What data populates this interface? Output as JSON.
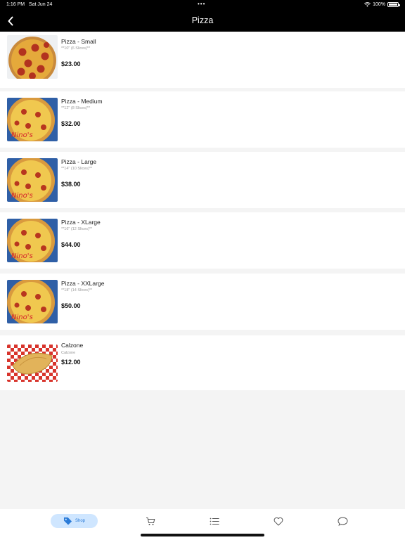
{
  "status_bar": {
    "time": "1:16 PM",
    "date": "Sat Jun 24",
    "battery": "100%"
  },
  "header": {
    "title": "Pizza",
    "back_icon": "chevron-left-icon"
  },
  "items": [
    {
      "name": "Pizza - Small",
      "description": "**10\" (6 Slices)**",
      "price": "$23.00"
    },
    {
      "name": "Pizza - Medium",
      "description": "**12\" (8 Slices)**",
      "price": "$32.00"
    },
    {
      "name": "Pizza - Large",
      "description": "**14\" (10 Slices)**",
      "price": "$38.00"
    },
    {
      "name": "Pizza - XLarge",
      "description": "**16\" (12 Slices)**",
      "price": "$44.00"
    },
    {
      "name": "Pizza - XXLarge",
      "description": "**18\" (14 Slices)**",
      "price": "$50.00"
    },
    {
      "name": "Calzone",
      "description": "Calzone",
      "price": "$12.00"
    }
  ],
  "tabbar": {
    "shop_label": "Shop",
    "icons": [
      "tag-icon",
      "cart-icon",
      "list-icon",
      "heart-icon",
      "chat-bubble-icon"
    ]
  },
  "colors": {
    "header_bg": "#000000",
    "accent": "#2a7bd8",
    "accent_bg": "#cfe6ff"
  }
}
